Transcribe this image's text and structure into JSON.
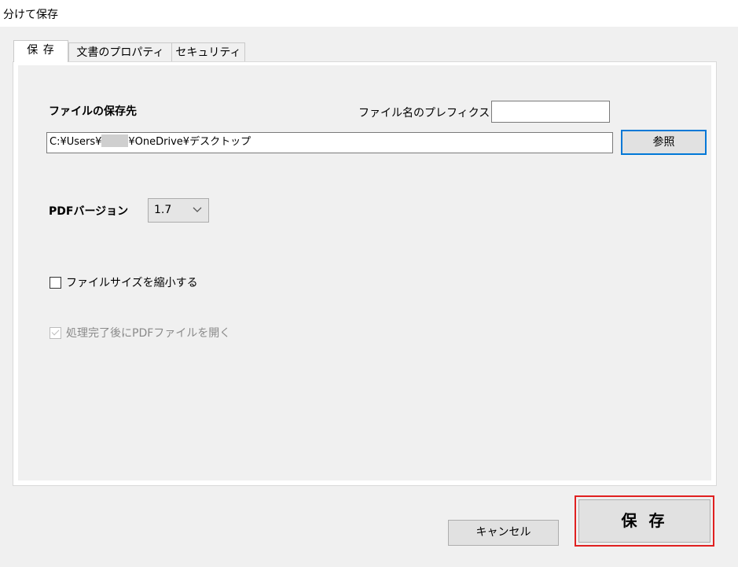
{
  "window": {
    "title": "分けて保存"
  },
  "tabs": [
    {
      "label": "保 存",
      "active": true
    },
    {
      "label": "文書のプロパティ",
      "active": false
    },
    {
      "label": "セキュリティ",
      "active": false
    }
  ],
  "save_tab": {
    "destination_label": "ファイルの保存先",
    "prefix_label": "ファイル名のプレフィクス",
    "prefix_value": "",
    "path_prefix": "C:¥Users¥",
    "path_suffix": "¥OneDrive¥デスクトップ",
    "browse_label": "参照",
    "pdf_version_label": "PDFバージョン",
    "pdf_version_value": "1.7",
    "reduce_size_label": "ファイルサイズを縮小する",
    "reduce_size_checked": false,
    "open_after_label": "処理完了後にPDFファイルを開く",
    "open_after_checked": true,
    "open_after_disabled": true
  },
  "footer": {
    "cancel_label": "キャンセル",
    "save_label": "保 存"
  },
  "colors": {
    "highlight": "#e02020",
    "focus_border": "#0078d7"
  }
}
